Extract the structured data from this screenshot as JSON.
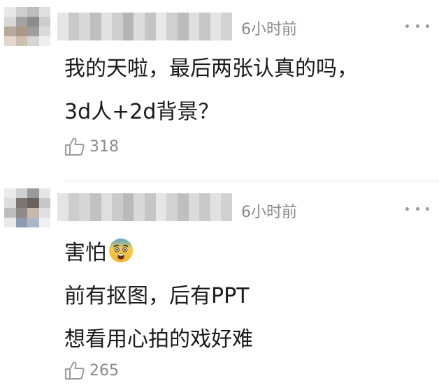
{
  "comments": [
    {
      "time": "6小时前",
      "lines": [
        "我的天啦，最后两张认真的吗，",
        "3d人+2d背景？"
      ],
      "likes": "318",
      "avatar_colors": [
        "#e8e8e8",
        "#cfcfcf",
        "#bdbdbd",
        "#e0e0e0",
        "#d9d9d9",
        "#a3a3a3",
        "#8c8c8c",
        "#cccccc",
        "#b8a89a",
        "#a99886",
        "#9e9e9e",
        "#dadada",
        "#e2d8cc",
        "#cdbfae",
        "#d4d4d4",
        "#efefef"
      ],
      "username_colors": [
        "#e6e6e6",
        "#c9c9c9",
        "#d8d8d8",
        "#bfbfbf",
        "#e2e2e2",
        "#cfcfcf",
        "#b5b5b5",
        "#dcdcdc",
        "#c4c4c4",
        "#e8e8e8",
        "#d0d0d0",
        "#bcbcbc",
        "#dedede",
        "#c7c7c7",
        "#e4e4e4",
        "#d3d3d3"
      ]
    },
    {
      "time": "6小时前",
      "lines": [
        "害怕",
        "前有抠图，后有PPT",
        "想看用心拍的戏好难"
      ],
      "emoji": "anxious-face-emoji",
      "likes": "265",
      "avatar_colors": [
        "#ececec",
        "#d0d0d0",
        "#9a9a9a",
        "#e6e6e6",
        "#dcdcdc",
        "#7d7670",
        "#6a625c",
        "#c8c8c8",
        "#bdbdbd",
        "#8f8a86",
        "#c9b9aa",
        "#e0e0e0",
        "#e9e9e9",
        "#8d9bb3",
        "#aeb7c7",
        "#f0f0f0"
      ],
      "username_colors": [
        "#e4e4e4",
        "#cdcdcd",
        "#d6d6d6",
        "#c2c2c2",
        "#dfdfdf",
        "#cbcbcb",
        "#b9b9b9",
        "#d9d9d9",
        "#c6c6c6",
        "#e6e6e6",
        "#d2d2d2",
        "#bfbfbf",
        "#dbdbdb",
        "#c9c9c9",
        "#e2e2e2",
        "#d1d1d1"
      ]
    }
  ],
  "colors": {
    "text": "#1a1a1a",
    "meta": "#8a8a8a",
    "divider": "#e6e6e6"
  }
}
